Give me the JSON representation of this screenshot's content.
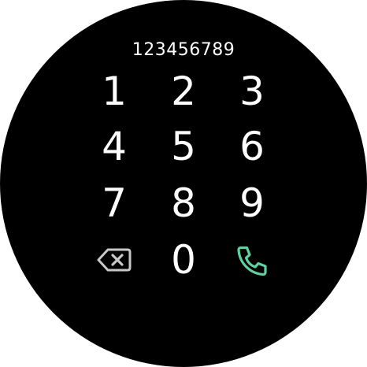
{
  "dialer": {
    "number": "123456789",
    "keys": [
      "1",
      "2",
      "3",
      "4",
      "5",
      "6",
      "7",
      "8",
      "9",
      "0"
    ],
    "backspace_icon": "backspace-icon",
    "call_icon": "phone-icon"
  },
  "colors": {
    "background": "#000000",
    "text": "#ffffff",
    "backspace": "#c8c8c8",
    "call": "#5fd1a1"
  }
}
